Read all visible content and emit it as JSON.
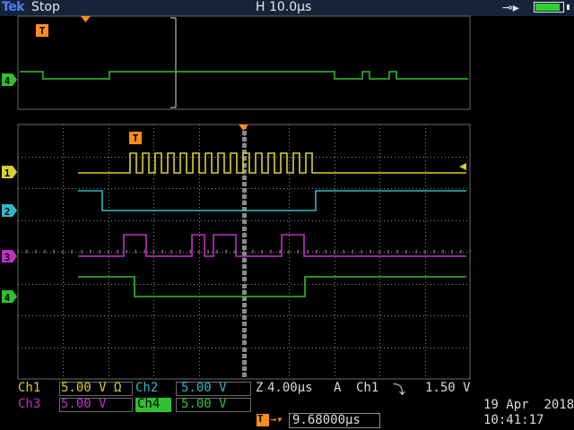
{
  "header": {
    "brand": "Tek",
    "run_state": "Stop",
    "horizontal_scale": "H 10.0µs",
    "battery_level": 0.9
  },
  "overview": {
    "trigger_marker": "T",
    "channel_marker": "4"
  },
  "main": {
    "trigger_marker": "T",
    "channel_markers": [
      "1",
      "2",
      "3",
      "4"
    ]
  },
  "bottom": {
    "ch1_label": "Ch1",
    "ch1_value": "5.00 V Ω",
    "ch2_label": "Ch2",
    "ch2_value": "5.00 V",
    "ch3_label": "Ch3",
    "ch3_value": "5.00 V",
    "ch4_label": "Ch4",
    "ch4_value": "5.00 V",
    "zoom_label": "Z",
    "zoom_value": "4.00µs",
    "trigger_mode": "A",
    "trigger_source": "Ch1",
    "trigger_slope": "⤵",
    "trigger_level": "1.50 V",
    "trigger_position_icon": "T→",
    "trigger_position": "9.68000µs",
    "date": "19 Apr  2018",
    "time": "10:41:17"
  },
  "colors": {
    "ch1": "#d8d030",
    "ch2": "#30b8c8",
    "ch3": "#c030c8",
    "ch4": "#30c030",
    "trigger": "#ff8c1a",
    "grid": "#8a8a8a"
  }
}
